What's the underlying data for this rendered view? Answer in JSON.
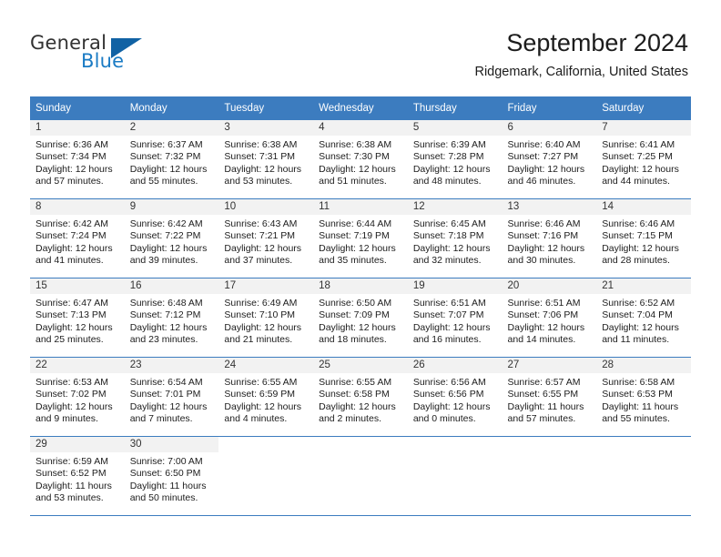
{
  "brand": {
    "name_top": "General",
    "name_bottom": "Blue",
    "color_dark": "#323232",
    "color_blue": "#1a7bc4",
    "triangle_color": "#1162a4"
  },
  "header": {
    "title": "September 2024",
    "subtitle": "Ridgemark, California, United States"
  },
  "theme": {
    "header_bg": "#3c7cbf",
    "header_text": "#ffffff",
    "daynum_bg": "#f2f2f2",
    "border": "#3c7cbf",
    "body_text": "#1c1c1c"
  },
  "labels": {
    "sunrise_prefix": "Sunrise:",
    "sunset_prefix": "Sunset:",
    "daylight_prefix": "Daylight:"
  },
  "weekdays": [
    "Sunday",
    "Monday",
    "Tuesday",
    "Wednesday",
    "Thursday",
    "Friday",
    "Saturday"
  ],
  "weeks": [
    [
      {
        "day": "1",
        "sunrise": "Sunrise: 6:36 AM",
        "sunset": "Sunset: 7:34 PM",
        "daylight_1": "Daylight: 12 hours",
        "daylight_2": "and 57 minutes."
      },
      {
        "day": "2",
        "sunrise": "Sunrise: 6:37 AM",
        "sunset": "Sunset: 7:32 PM",
        "daylight_1": "Daylight: 12 hours",
        "daylight_2": "and 55 minutes."
      },
      {
        "day": "3",
        "sunrise": "Sunrise: 6:38 AM",
        "sunset": "Sunset: 7:31 PM",
        "daylight_1": "Daylight: 12 hours",
        "daylight_2": "and 53 minutes."
      },
      {
        "day": "4",
        "sunrise": "Sunrise: 6:38 AM",
        "sunset": "Sunset: 7:30 PM",
        "daylight_1": "Daylight: 12 hours",
        "daylight_2": "and 51 minutes."
      },
      {
        "day": "5",
        "sunrise": "Sunrise: 6:39 AM",
        "sunset": "Sunset: 7:28 PM",
        "daylight_1": "Daylight: 12 hours",
        "daylight_2": "and 48 minutes."
      },
      {
        "day": "6",
        "sunrise": "Sunrise: 6:40 AM",
        "sunset": "Sunset: 7:27 PM",
        "daylight_1": "Daylight: 12 hours",
        "daylight_2": "and 46 minutes."
      },
      {
        "day": "7",
        "sunrise": "Sunrise: 6:41 AM",
        "sunset": "Sunset: 7:25 PM",
        "daylight_1": "Daylight: 12 hours",
        "daylight_2": "and 44 minutes."
      }
    ],
    [
      {
        "day": "8",
        "sunrise": "Sunrise: 6:42 AM",
        "sunset": "Sunset: 7:24 PM",
        "daylight_1": "Daylight: 12 hours",
        "daylight_2": "and 41 minutes."
      },
      {
        "day": "9",
        "sunrise": "Sunrise: 6:42 AM",
        "sunset": "Sunset: 7:22 PM",
        "daylight_1": "Daylight: 12 hours",
        "daylight_2": "and 39 minutes."
      },
      {
        "day": "10",
        "sunrise": "Sunrise: 6:43 AM",
        "sunset": "Sunset: 7:21 PM",
        "daylight_1": "Daylight: 12 hours",
        "daylight_2": "and 37 minutes."
      },
      {
        "day": "11",
        "sunrise": "Sunrise: 6:44 AM",
        "sunset": "Sunset: 7:19 PM",
        "daylight_1": "Daylight: 12 hours",
        "daylight_2": "and 35 minutes."
      },
      {
        "day": "12",
        "sunrise": "Sunrise: 6:45 AM",
        "sunset": "Sunset: 7:18 PM",
        "daylight_1": "Daylight: 12 hours",
        "daylight_2": "and 32 minutes."
      },
      {
        "day": "13",
        "sunrise": "Sunrise: 6:46 AM",
        "sunset": "Sunset: 7:16 PM",
        "daylight_1": "Daylight: 12 hours",
        "daylight_2": "and 30 minutes."
      },
      {
        "day": "14",
        "sunrise": "Sunrise: 6:46 AM",
        "sunset": "Sunset: 7:15 PM",
        "daylight_1": "Daylight: 12 hours",
        "daylight_2": "and 28 minutes."
      }
    ],
    [
      {
        "day": "15",
        "sunrise": "Sunrise: 6:47 AM",
        "sunset": "Sunset: 7:13 PM",
        "daylight_1": "Daylight: 12 hours",
        "daylight_2": "and 25 minutes."
      },
      {
        "day": "16",
        "sunrise": "Sunrise: 6:48 AM",
        "sunset": "Sunset: 7:12 PM",
        "daylight_1": "Daylight: 12 hours",
        "daylight_2": "and 23 minutes."
      },
      {
        "day": "17",
        "sunrise": "Sunrise: 6:49 AM",
        "sunset": "Sunset: 7:10 PM",
        "daylight_1": "Daylight: 12 hours",
        "daylight_2": "and 21 minutes."
      },
      {
        "day": "18",
        "sunrise": "Sunrise: 6:50 AM",
        "sunset": "Sunset: 7:09 PM",
        "daylight_1": "Daylight: 12 hours",
        "daylight_2": "and 18 minutes."
      },
      {
        "day": "19",
        "sunrise": "Sunrise: 6:51 AM",
        "sunset": "Sunset: 7:07 PM",
        "daylight_1": "Daylight: 12 hours",
        "daylight_2": "and 16 minutes."
      },
      {
        "day": "20",
        "sunrise": "Sunrise: 6:51 AM",
        "sunset": "Sunset: 7:06 PM",
        "daylight_1": "Daylight: 12 hours",
        "daylight_2": "and 14 minutes."
      },
      {
        "day": "21",
        "sunrise": "Sunrise: 6:52 AM",
        "sunset": "Sunset: 7:04 PM",
        "daylight_1": "Daylight: 12 hours",
        "daylight_2": "and 11 minutes."
      }
    ],
    [
      {
        "day": "22",
        "sunrise": "Sunrise: 6:53 AM",
        "sunset": "Sunset: 7:02 PM",
        "daylight_1": "Daylight: 12 hours",
        "daylight_2": "and 9 minutes."
      },
      {
        "day": "23",
        "sunrise": "Sunrise: 6:54 AM",
        "sunset": "Sunset: 7:01 PM",
        "daylight_1": "Daylight: 12 hours",
        "daylight_2": "and 7 minutes."
      },
      {
        "day": "24",
        "sunrise": "Sunrise: 6:55 AM",
        "sunset": "Sunset: 6:59 PM",
        "daylight_1": "Daylight: 12 hours",
        "daylight_2": "and 4 minutes."
      },
      {
        "day": "25",
        "sunrise": "Sunrise: 6:55 AM",
        "sunset": "Sunset: 6:58 PM",
        "daylight_1": "Daylight: 12 hours",
        "daylight_2": "and 2 minutes."
      },
      {
        "day": "26",
        "sunrise": "Sunrise: 6:56 AM",
        "sunset": "Sunset: 6:56 PM",
        "daylight_1": "Daylight: 12 hours",
        "daylight_2": "and 0 minutes."
      },
      {
        "day": "27",
        "sunrise": "Sunrise: 6:57 AM",
        "sunset": "Sunset: 6:55 PM",
        "daylight_1": "Daylight: 11 hours",
        "daylight_2": "and 57 minutes."
      },
      {
        "day": "28",
        "sunrise": "Sunrise: 6:58 AM",
        "sunset": "Sunset: 6:53 PM",
        "daylight_1": "Daylight: 11 hours",
        "daylight_2": "and 55 minutes."
      }
    ],
    [
      {
        "day": "29",
        "sunrise": "Sunrise: 6:59 AM",
        "sunset": "Sunset: 6:52 PM",
        "daylight_1": "Daylight: 11 hours",
        "daylight_2": "and 53 minutes."
      },
      {
        "day": "30",
        "sunrise": "Sunrise: 7:00 AM",
        "sunset": "Sunset: 6:50 PM",
        "daylight_1": "Daylight: 11 hours",
        "daylight_2": "and 50 minutes."
      },
      {
        "day": "",
        "sunrise": "",
        "sunset": "",
        "daylight_1": "",
        "daylight_2": ""
      },
      {
        "day": "",
        "sunrise": "",
        "sunset": "",
        "daylight_1": "",
        "daylight_2": ""
      },
      {
        "day": "",
        "sunrise": "",
        "sunset": "",
        "daylight_1": "",
        "daylight_2": ""
      },
      {
        "day": "",
        "sunrise": "",
        "sunset": "",
        "daylight_1": "",
        "daylight_2": ""
      },
      {
        "day": "",
        "sunrise": "",
        "sunset": "",
        "daylight_1": "",
        "daylight_2": ""
      }
    ]
  ]
}
